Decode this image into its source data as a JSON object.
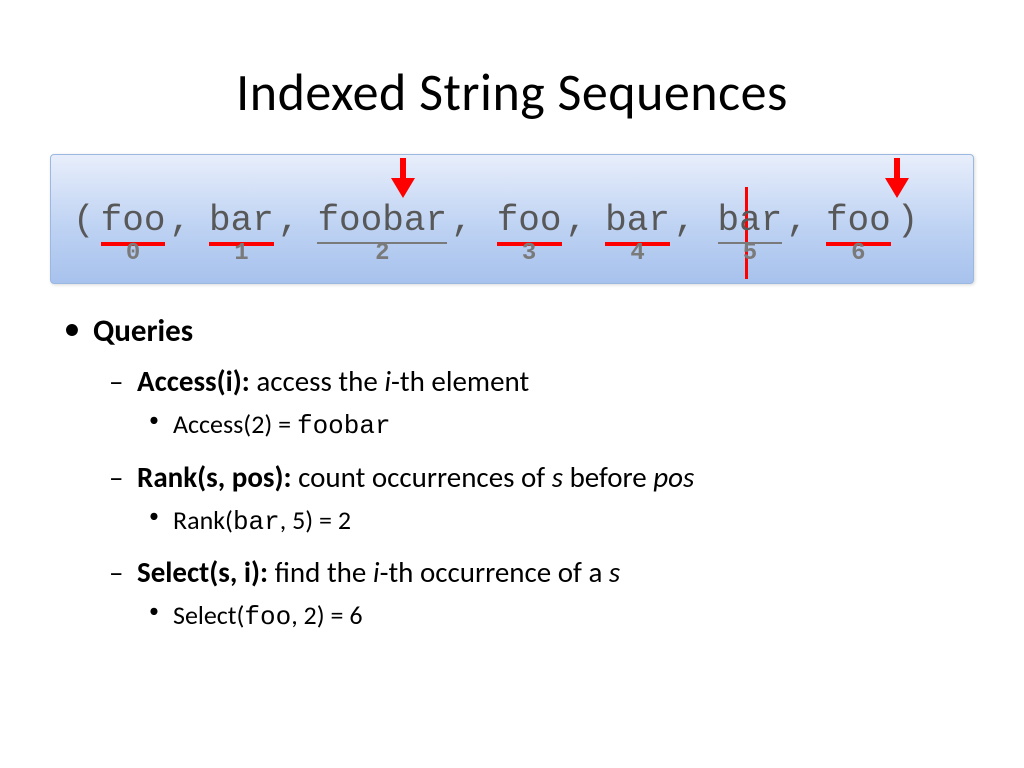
{
  "title": "Indexed String Sequences",
  "sequence": {
    "open": "(",
    "close": ")",
    "items": [
      {
        "text": "foo",
        "index": "0",
        "underline": "red"
      },
      {
        "text": "bar",
        "index": "1",
        "underline": "red"
      },
      {
        "text": "foobar",
        "index": "2",
        "underline": "gray"
      },
      {
        "text": "foo",
        "index": "3",
        "underline": "red"
      },
      {
        "text": "bar",
        "index": "4",
        "underline": "red"
      },
      {
        "text": "bar",
        "index": "5",
        "underline": "gray"
      },
      {
        "text": "foo",
        "index": "6",
        "underline": "red"
      }
    ]
  },
  "bullets": {
    "queries": "Queries",
    "access": {
      "head_bold": "Access(i): ",
      "head_rest_a": "access the ",
      "head_rest_i": "i",
      "head_rest_b": "-th element",
      "ex_a": "Access(2) = ",
      "ex_mono": "foobar"
    },
    "rank": {
      "head_bold": "Rank(s, pos): ",
      "head_rest_a": "count occurrences of ",
      "head_rest_s": "s",
      "head_rest_b": " before ",
      "head_rest_pos": "pos",
      "ex_a": "Rank(",
      "ex_mono": "bar",
      "ex_b": ", 5) = 2"
    },
    "select": {
      "head_bold": "Select(s, i): ",
      "head_rest_a": "find the ",
      "head_rest_i": "i",
      "head_rest_b": "-th occurrence of a ",
      "head_rest_s": "s",
      "ex_a": "Select(",
      "ex_mono": "foo",
      "ex_b": ", 2) = 6"
    }
  }
}
